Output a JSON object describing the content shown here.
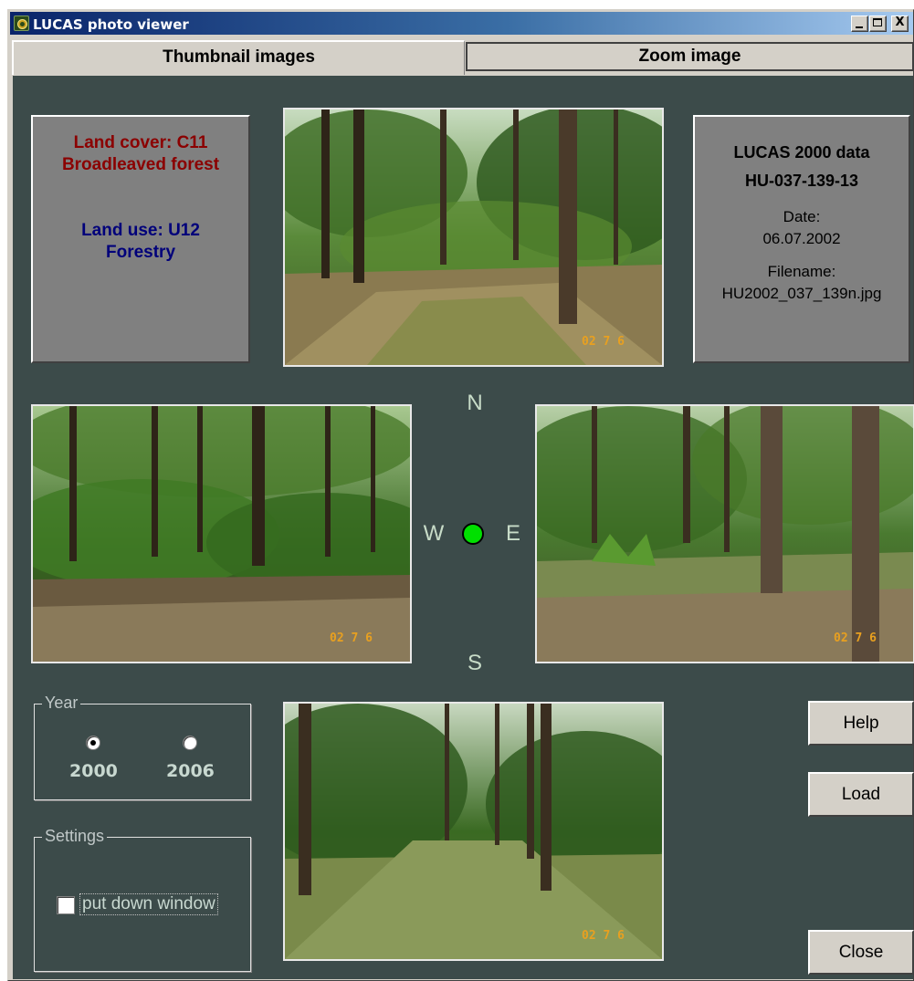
{
  "window": {
    "title": "LUCAS photo viewer",
    "controls": {
      "minimize": "_",
      "maximize": "□",
      "close": "X"
    }
  },
  "tabs": [
    {
      "label": "Thumbnail images",
      "selected": true
    },
    {
      "label": "Zoom image",
      "selected": false
    }
  ],
  "land_info": {
    "cover_line1": "Land cover: C11",
    "cover_line2": "Broadleaved forest",
    "use_line1": "Land use: U12",
    "use_line2": "Forestry",
    "cover_color": "#8b0000",
    "use_color": "#00007a"
  },
  "data_info": {
    "heading": "LUCAS 2000 data",
    "point_id": "HU-037-139-13",
    "date_label": "Date:",
    "date_value": "06.07.2002",
    "filename_label": "Filename:",
    "filename_value": "HU2002_037_139n.jpg"
  },
  "photos": {
    "north": {
      "stamp": "02 7 6"
    },
    "west": {
      "stamp": "02 7 6"
    },
    "east": {
      "stamp": "02 7 6"
    },
    "south": {
      "stamp": "02 7 6"
    }
  },
  "compass": {
    "n": "N",
    "s": "S",
    "w": "W",
    "e": "E",
    "marker_color": "#00e000"
  },
  "year_group": {
    "title": "Year",
    "options": [
      {
        "label": "2000",
        "checked": true
      },
      {
        "label": "2006",
        "checked": false
      }
    ]
  },
  "settings_group": {
    "title": "Settings",
    "checkbox_label": "put down window",
    "checked": false
  },
  "buttons": {
    "help": "Help",
    "load": "Load",
    "close": "Close"
  },
  "colors": {
    "background": "#3c4b4a",
    "panel": "#808080"
  }
}
